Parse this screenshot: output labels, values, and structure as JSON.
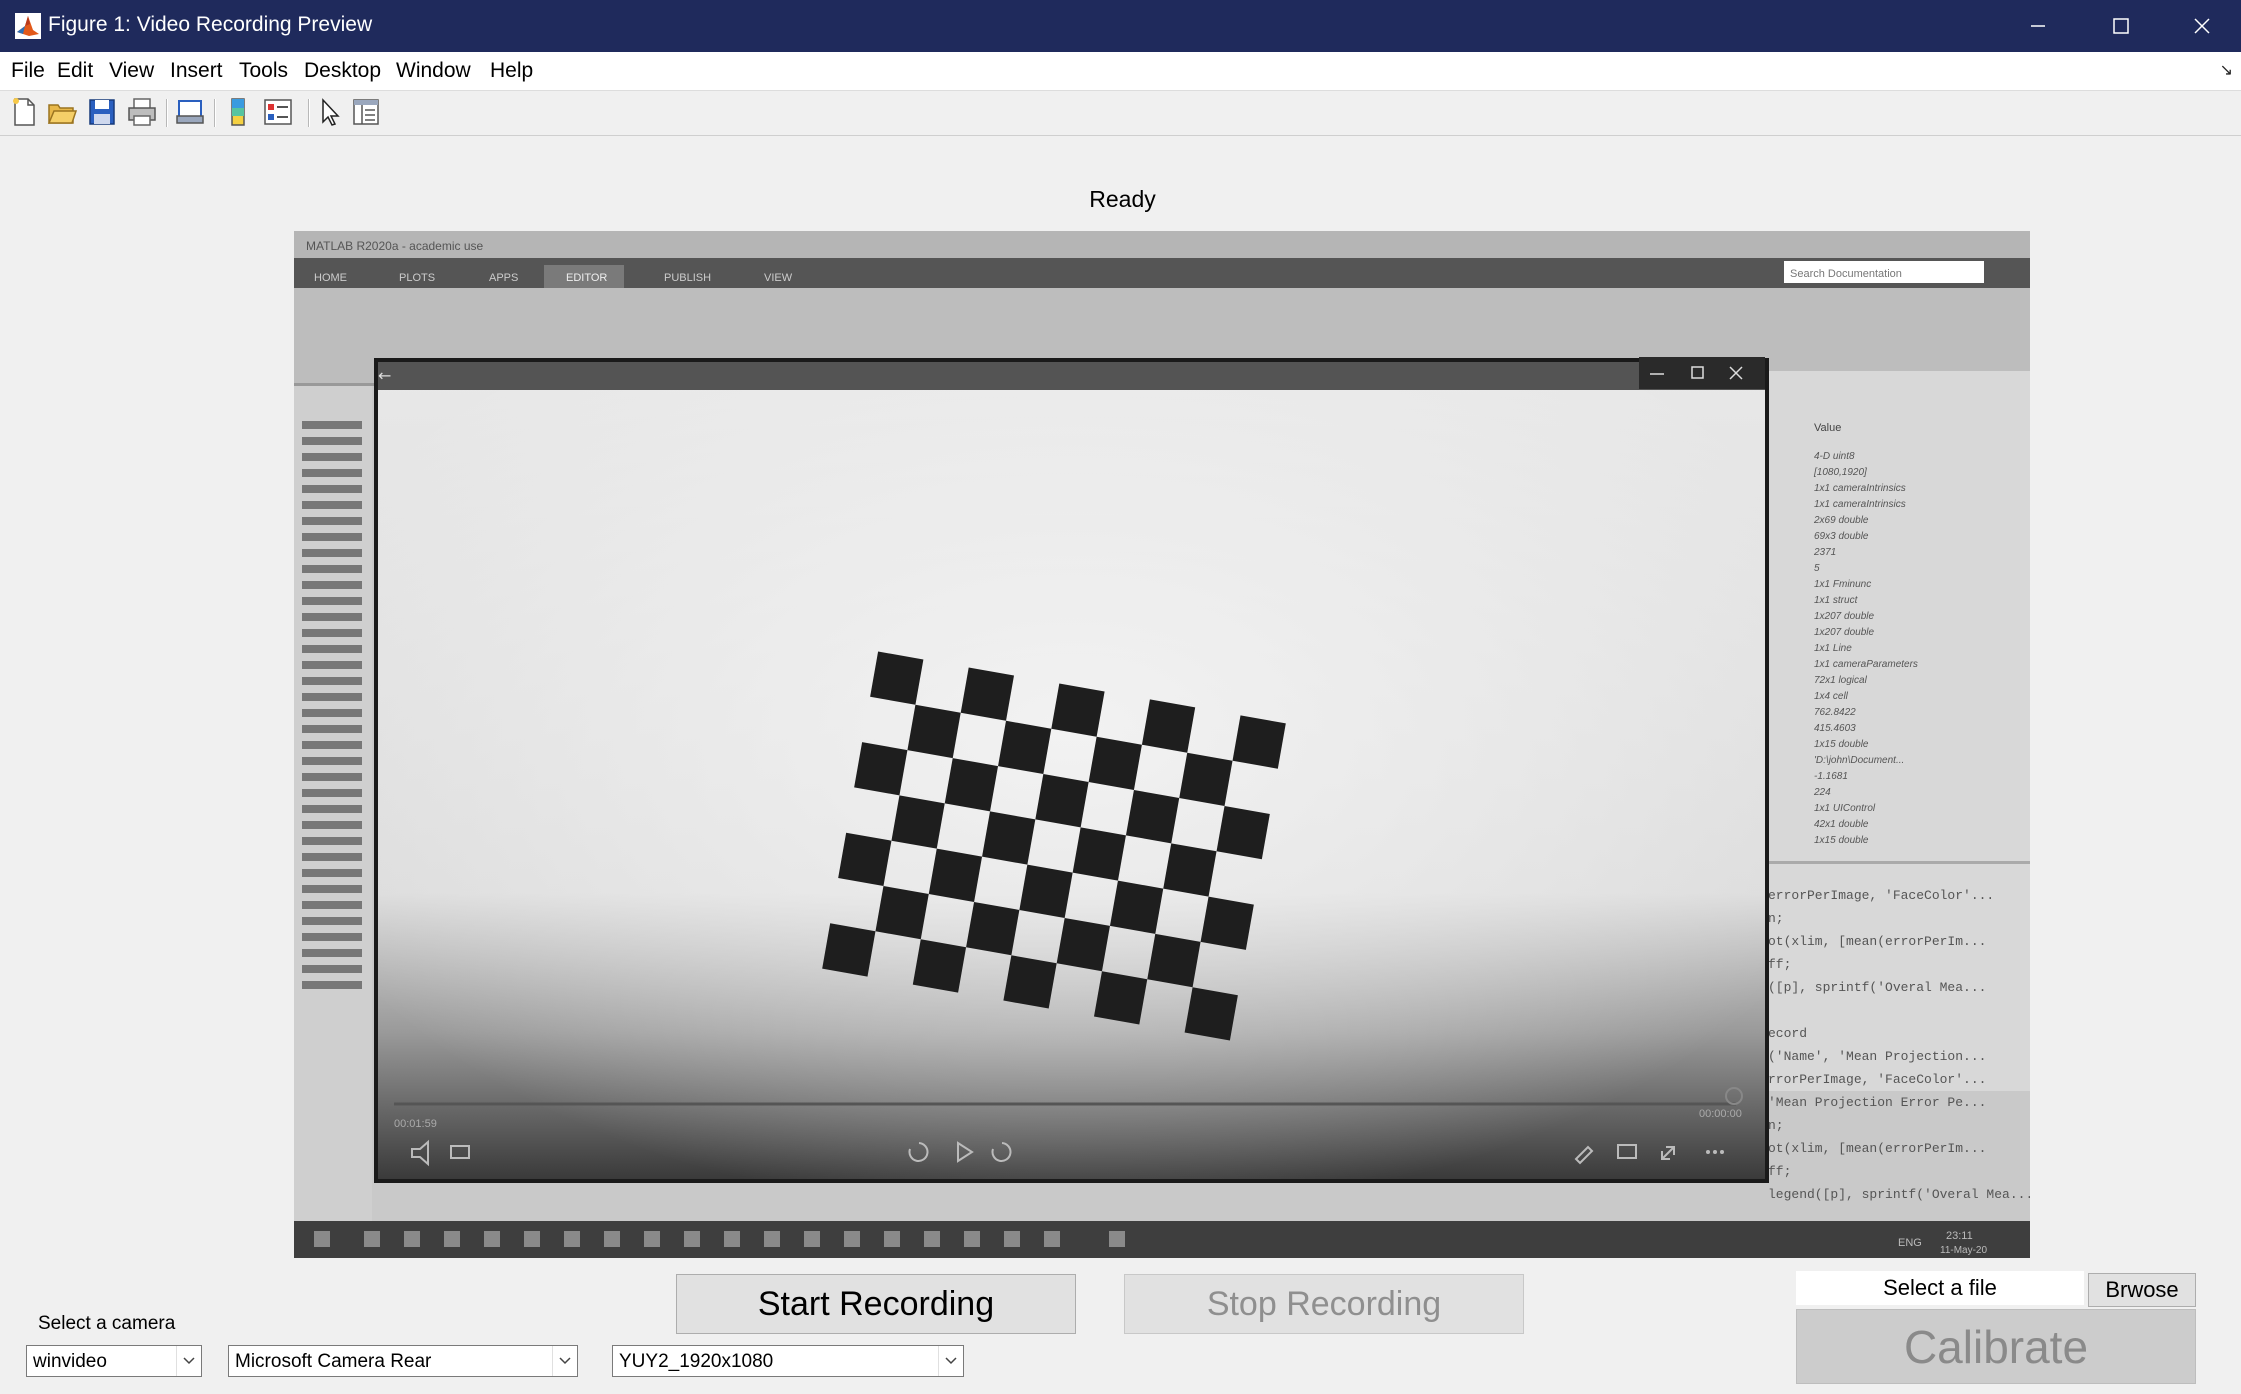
{
  "window": {
    "title": "Figure 1: Video Recording Preview",
    "controls": [
      "minimize-icon",
      "maximize-icon",
      "close-icon"
    ],
    "title_bar_color": "#1f2a5c"
  },
  "menu": {
    "items": [
      "File",
      "Edit",
      "View",
      "Insert",
      "Tools",
      "Desktop",
      "Window",
      "Help"
    ]
  },
  "toolbar": {
    "icons": [
      "new-figure-icon",
      "open-file-icon",
      "save-icon",
      "print-icon",
      "print-preview-icon",
      "colorbar-icon",
      "legend-icon",
      "edit-plot-icon",
      "property-inspector-icon"
    ]
  },
  "status": {
    "text": "Ready"
  },
  "preview": {
    "description_icon": "camera-preview",
    "background_window_title": "MATLAB R2020a - academic use",
    "background_tabs": [
      "HOME",
      "PLOTS",
      "APPS",
      "EDITOR",
      "PUBLISH",
      "VIEW"
    ],
    "search_placeholder": "Search Documentation",
    "player_time_elapsed": "00:01:59",
    "player_time_total": "00:00:00",
    "workspace_header": "Value",
    "workspace_values": [
      "4-D uint8",
      "[1080,1920]",
      "1x1 cameraIntrinsics",
      "1x1 cameraIntrinsics",
      "2x69 double",
      "69x3 double",
      "2371",
      "5",
      "1x1 Fminunc",
      "1x1 struct",
      "1x207 double",
      "1x207 double",
      "1x1 Line",
      "1x1 cameraParameters",
      "72x1 logical",
      "1x4 cell",
      "762.8422",
      "415.4603",
      "1x15 double",
      "'D:\\john\\Document...",
      "-1.1681",
      "224",
      "1x1 UIControl",
      "42x1 double",
      "1x15 double"
    ],
    "code_lines": [
      "errorPerImage, 'FaceColor'...",
      "n;",
      "ot(xlim, [mean(errorPerIm...",
      "ff;",
      "([p], sprintf('Overal Mea...",
      "ecord",
      "('Name', 'Mean Projection...",
      "rrorPerImage, 'FaceColor'...",
      "'Mean Projection Error Pe...",
      "n;",
      "ot(xlim, [mean(errorPerIm...",
      "ff;",
      "legend([p], sprintf('Overal Mea..."
    ],
    "taskbar_clock": "23:11",
    "taskbar_date": "11-May-20",
    "taskbar_lang": "ENG"
  },
  "controls": {
    "start_label": "Start Recording",
    "stop_label": "Stop Recording",
    "camera_label": "Select a camera",
    "adaptor_value": "winvideo",
    "device_value": "Microsoft Camera Rear",
    "format_value": "YUY2_1920x1080",
    "file_placeholder": "Select a file",
    "browse_label": "Brwose",
    "calibrate_label": "Calibrate"
  }
}
